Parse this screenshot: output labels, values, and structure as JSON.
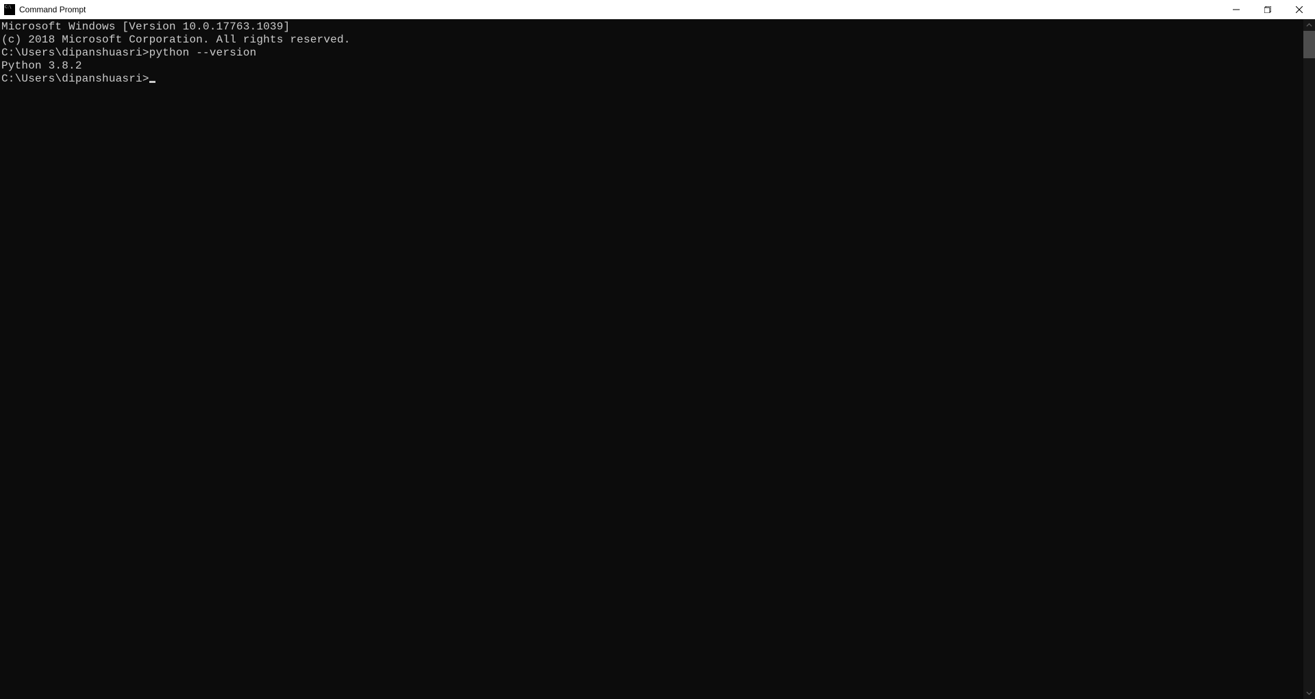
{
  "titlebar": {
    "title": "Command Prompt"
  },
  "terminal": {
    "line1": "Microsoft Windows [Version 10.0.17763.1039]",
    "line2": "(c) 2018 Microsoft Corporation. All rights reserved.",
    "blank1": "",
    "prompt1": "C:\\Users\\dipanshuasri>",
    "command1": "python --version",
    "output1": "Python 3.8.2",
    "blank2": "",
    "prompt2": "C:\\Users\\dipanshuasri>"
  }
}
